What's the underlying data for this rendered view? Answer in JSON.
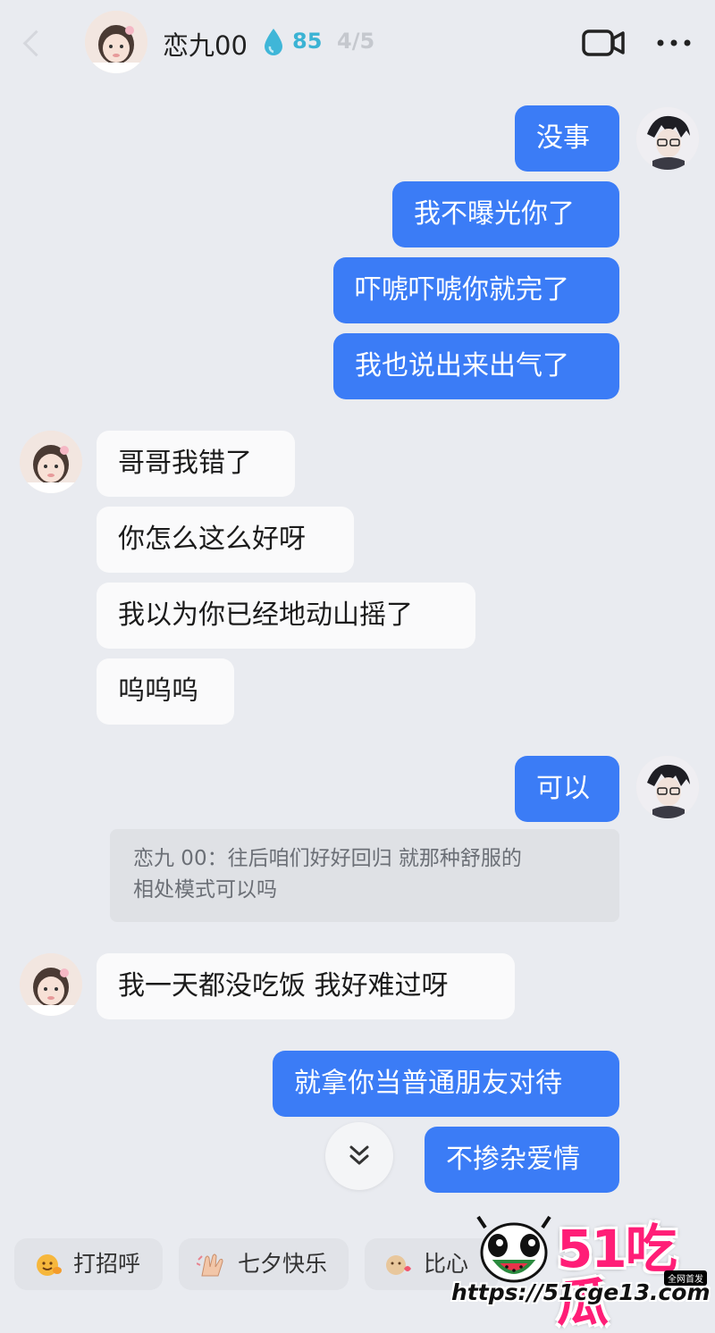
{
  "header": {
    "contact_name": "恋九00",
    "intimacy_value": "85",
    "page_indicator": "4/5"
  },
  "messages": [
    {
      "id": "m1",
      "side": "out",
      "text": "没事"
    },
    {
      "id": "m2",
      "side": "out",
      "text": "我不曝光你了"
    },
    {
      "id": "m3",
      "side": "out",
      "text": "吓唬吓唬你就完了"
    },
    {
      "id": "m4",
      "side": "out",
      "text": "我也说出来出气了"
    },
    {
      "id": "m5",
      "side": "in",
      "text": "哥哥我错了"
    },
    {
      "id": "m6",
      "side": "in",
      "text": "你怎么这么好呀"
    },
    {
      "id": "m7",
      "side": "in",
      "text": "我以为你已经地动山摇了"
    },
    {
      "id": "m8",
      "side": "in",
      "text": "呜呜呜"
    },
    {
      "id": "m9",
      "side": "out",
      "text": "可以"
    },
    {
      "id": "m10",
      "side": "in",
      "text": "我一天都没吃饭 我好难过呀"
    },
    {
      "id": "m11",
      "side": "out",
      "text": "就拿你当普通朋友对待"
    },
    {
      "id": "m12",
      "side": "out",
      "text": "不掺杂爱情"
    }
  ],
  "quote": {
    "line1": "恋九 00：往后咱们好好回归 就那种舒服的",
    "line2": "相处模式可以吗"
  },
  "quick_replies": [
    {
      "label": "打招呼",
      "icon": "wave-emoji-icon"
    },
    {
      "label": "七夕快乐",
      "icon": "hands-emoji-icon"
    },
    {
      "label": "比心",
      "icon": "heart-hand-emoji-icon"
    }
  ],
  "watermark": {
    "logo": "51吃瓜",
    "badge": "全网首发",
    "url": "https://51cge13.com"
  }
}
